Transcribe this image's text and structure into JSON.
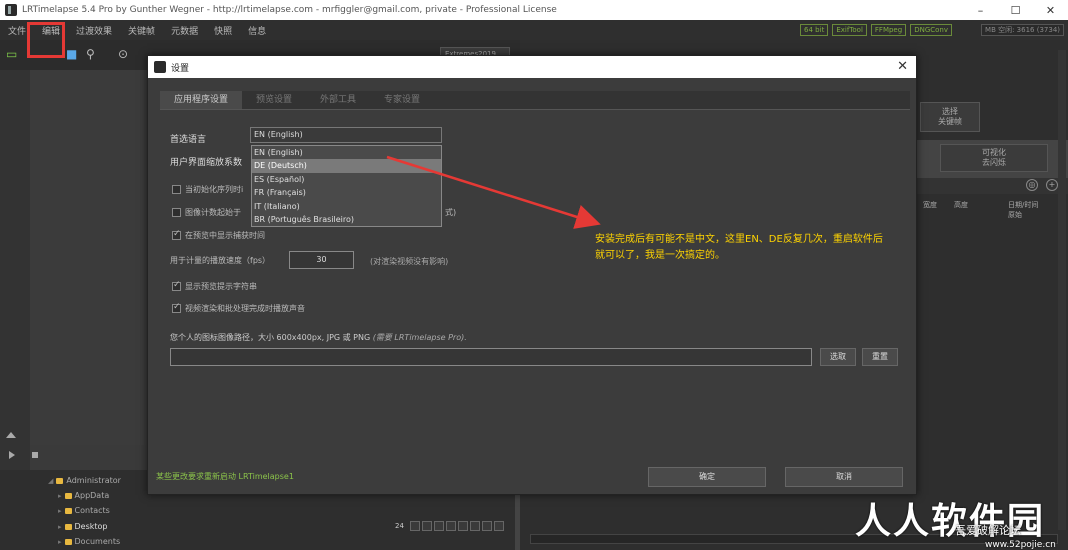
{
  "window": {
    "title": "LRTimelapse 5.4 Pro by Gunther Wegner - http://lrtimelapse.com - mrfiggler@gmail.com, private - Professional License",
    "min": "–",
    "max": "☐",
    "close": "✕"
  },
  "menu": {
    "items": [
      "文件",
      "编辑",
      "过渡效果",
      "关键帧",
      "元数据",
      "快照",
      "信息"
    ],
    "tags": [
      "64 bit",
      "ExifTool",
      "FFMpeg",
      "DNGConv"
    ],
    "memory": "MB 空闲: 3616 (3734)"
  },
  "toolbar": {
    "combo": "Extremes2019"
  },
  "tree": {
    "items": [
      "Administrator",
      "AppData",
      "Contacts",
      "Desktop",
      "Documents"
    ],
    "timeline_count": "24"
  },
  "right": {
    "card1": "选择\n关键帧",
    "card2": "可视化\n去闪烁",
    "headers": [
      "宽度",
      "高度",
      "日期/时间\n原始"
    ]
  },
  "dialog": {
    "title": "设置",
    "close": "✕",
    "tabs": [
      "应用程序设置",
      "预览设置",
      "外部工具",
      "专家设置"
    ],
    "language_label": "首选语言",
    "language_value": "EN (English)",
    "language_options": [
      "EN (English)",
      "DE (Deutsch)",
      "ES (Español)",
      "FR (Français)",
      "IT (Italiano)",
      "BR (Português Brasileiro)"
    ],
    "highlighted_option": 1,
    "ui_scale_label": "用户界面缩放系数",
    "cb1_label": "当初始化序列时i",
    "cb2_label": "图像计数起始于",
    "cb2_suffix": "式)",
    "cb3_label": "在预览中显示捕获时间",
    "fps_label": "用于计量的播放速度（fps）",
    "fps_value": "30",
    "fps_hint": "(对渲染视频没有影响)",
    "cb4_label": "显示预览提示字符串",
    "cb5_label": "视频渲染和批处理完成时播放声音",
    "logo_label": "您个人的图标图像路径，大小 600x400px, JPG 或 PNG",
    "logo_note": "(需要 LRTimelapse Pro).",
    "choose_button": "选取",
    "reset_button": "重置",
    "restart_note": "某些更改要求重新启动 LRTimelapse1",
    "ok_button": "确定",
    "cancel_button": "取消"
  },
  "annotation": {
    "text": "安装完成后有可能不是中文，这里EN、DE反复几次，重启软件后就可以了，我是一次搞定的。",
    "color": "#ffd400",
    "arrow_color": "#e53935"
  },
  "watermark": {
    "brand": "人人软件园",
    "sub": "吾爱破解论坛",
    "url": "www.52pojie.cn"
  }
}
